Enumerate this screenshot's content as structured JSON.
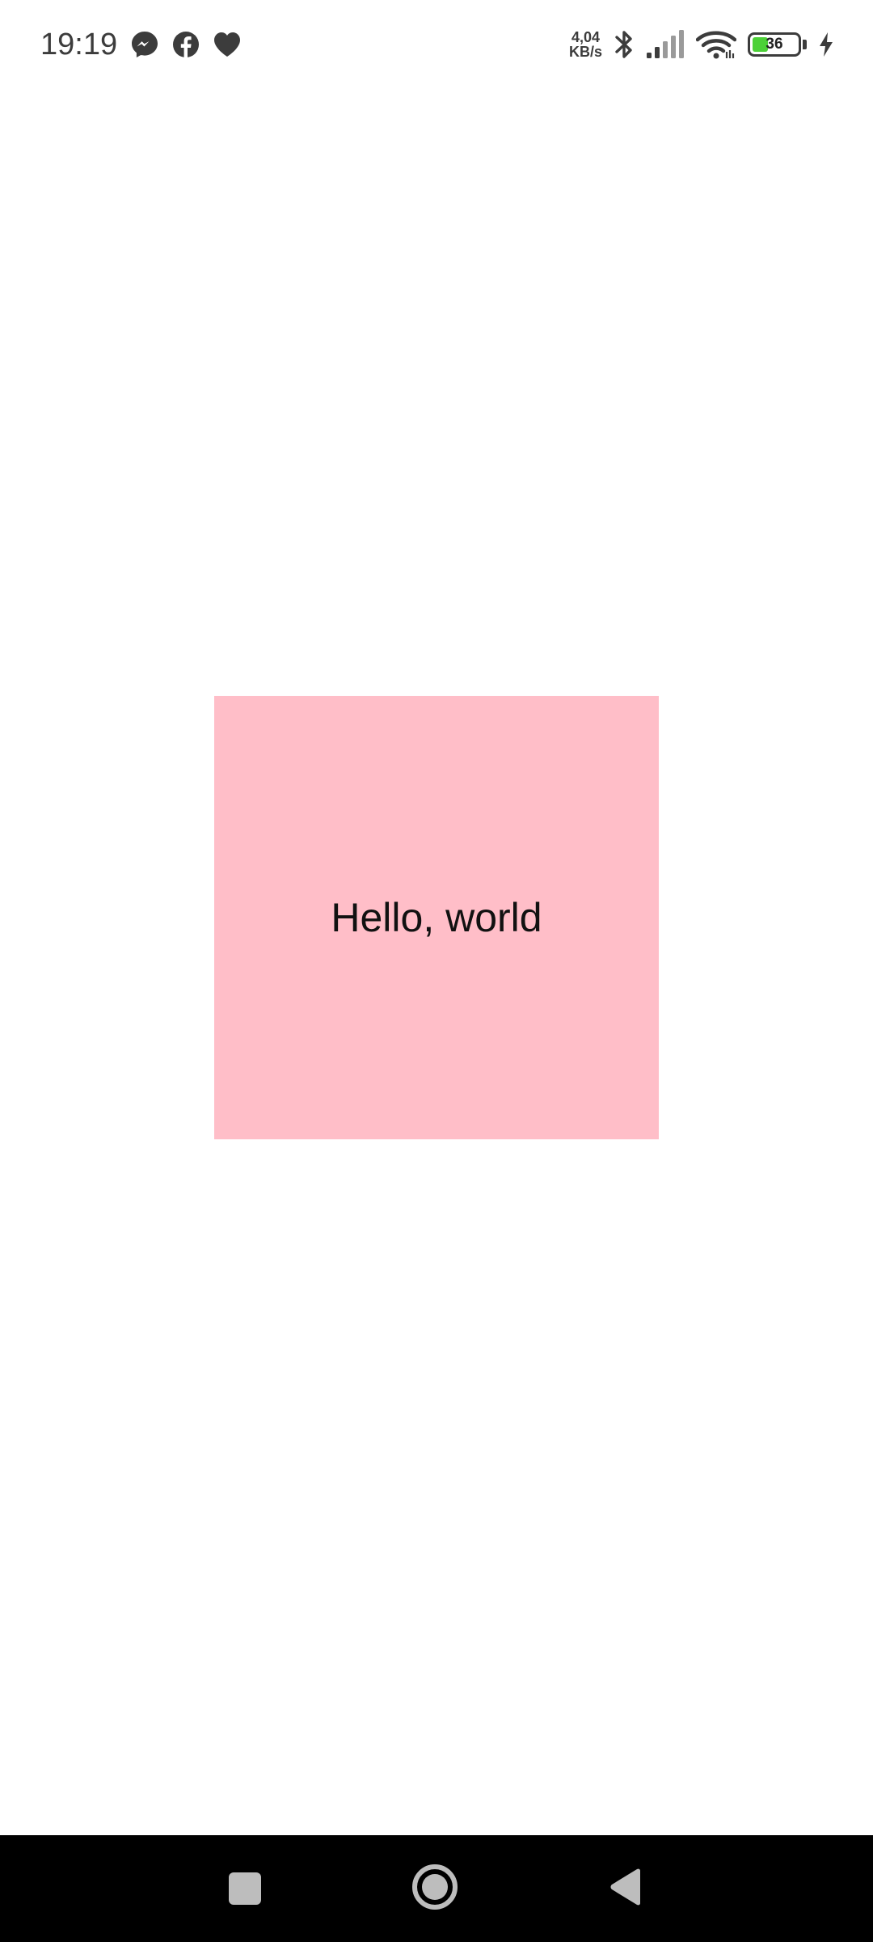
{
  "status_bar": {
    "time": "19:19",
    "notification_icons": [
      "messenger-icon",
      "facebook-icon",
      "heart-icon"
    ],
    "net_speed_value": "4,04",
    "net_speed_unit": "KB/s",
    "battery_level": "36",
    "battery_fraction": 0.36,
    "battery_color": "#4cd137",
    "charging": true
  },
  "main": {
    "card_text": "Hello, world",
    "card_color": "#ffbec8"
  },
  "nav_bar": {
    "buttons": [
      "recents-button",
      "home-button",
      "back-button"
    ]
  }
}
